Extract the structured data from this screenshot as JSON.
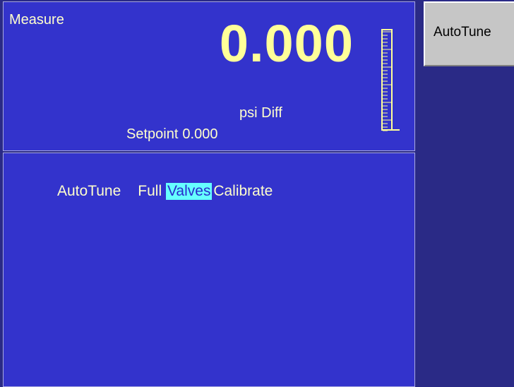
{
  "measure": {
    "title": "Measure",
    "reading": "0.000",
    "unit": "psi Diff",
    "setpoint_label": "Setpoint",
    "setpoint_value": "0.000",
    "gauge_fill": 0.0
  },
  "autotune": {
    "label": "AutoTune",
    "options": [
      "Full",
      "Valves",
      "Calibrate"
    ],
    "selected": "Valves"
  },
  "softkeys": {
    "autotune_label": "AutoTune"
  },
  "colors": {
    "panel_bg": "#3333cc",
    "panel_border": "#a8a8e0",
    "text": "#ffffcc",
    "reading": "#ffff99",
    "highlight": "#66ffff",
    "softkey_bg": "#c6c6c6"
  }
}
